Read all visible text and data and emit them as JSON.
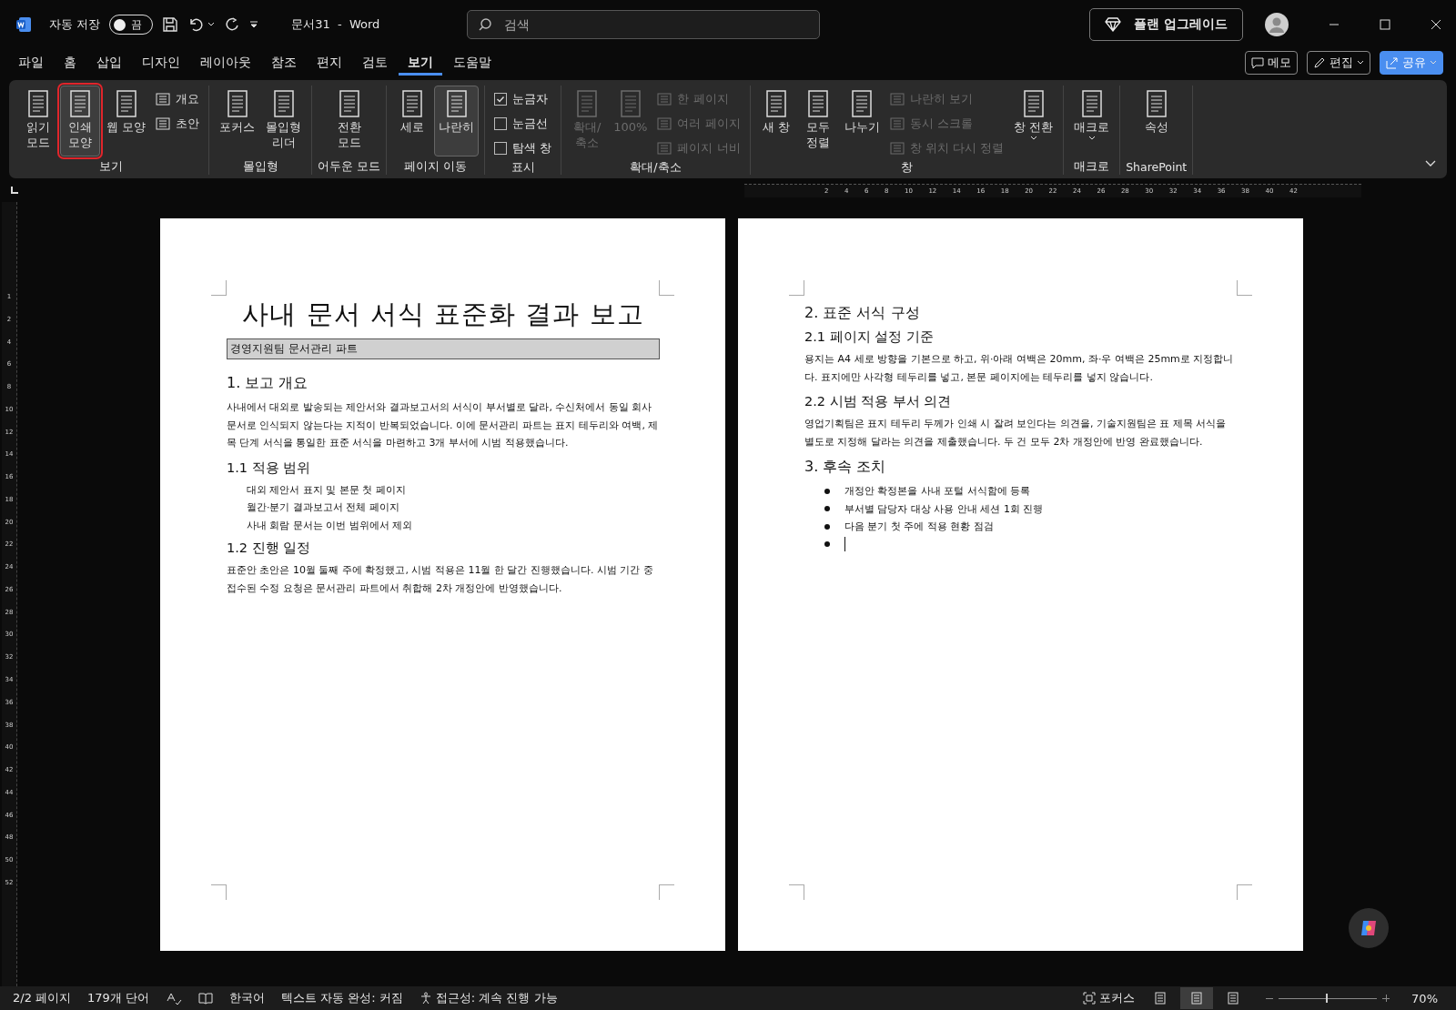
{
  "titlebar": {
    "autosave_label": "자동 저장",
    "autosave": {
      "on": false,
      "text": "끔"
    },
    "doc_title": "문서31  -  Word",
    "search": {
      "placeholder": "검색"
    },
    "upgrade_button": "플랜 업그레이드"
  },
  "menu_tabs": [
    {
      "label": "파일",
      "selected": false
    },
    {
      "label": "홈",
      "selected": false
    },
    {
      "label": "삽입",
      "selected": false
    },
    {
      "label": "디자인",
      "selected": false
    },
    {
      "label": "레이아웃",
      "selected": false
    },
    {
      "label": "참조",
      "selected": false
    },
    {
      "label": "편지",
      "selected": false
    },
    {
      "label": "검토",
      "selected": false
    },
    {
      "label": "보기",
      "selected": true
    },
    {
      "label": "도움말",
      "selected": false
    }
  ],
  "menu_buttons": [
    {
      "kind": "comment",
      "label": "메모"
    },
    {
      "kind": "edit",
      "label": "편집"
    },
    {
      "kind": "share",
      "label": "공유"
    }
  ],
  "ribbon_groups": [
    {
      "label": "보기",
      "items": [
        {
          "kind": "large",
          "label": "읽기\n모드",
          "selected": false,
          "disabled": false,
          "highlighted": false
        },
        {
          "kind": "large",
          "label": "인쇄\n모양",
          "selected": true,
          "disabled": false,
          "highlighted": true
        },
        {
          "kind": "large",
          "label": "웹 모양",
          "selected": false,
          "disabled": false,
          "highlighted": false
        },
        {
          "kind": "small",
          "label": "개요",
          "disabled": false
        },
        {
          "kind": "small",
          "label": "초안",
          "disabled": false
        }
      ]
    },
    {
      "label": "몰입형",
      "items": [
        {
          "kind": "large",
          "label": "포커스",
          "selected": false,
          "disabled": false,
          "highlighted": false
        },
        {
          "kind": "large",
          "label": "몰입형\n리더",
          "selected": false,
          "disabled": false,
          "highlighted": false
        }
      ]
    },
    {
      "label": "어두운 모드",
      "items": [
        {
          "kind": "large",
          "label": "전환\n모드",
          "selected": false,
          "disabled": false,
          "highlighted": false
        }
      ]
    },
    {
      "label": "페이지 이동",
      "items": [
        {
          "kind": "large",
          "label": "세로",
          "selected": false,
          "disabled": false,
          "highlighted": false
        },
        {
          "kind": "large",
          "label": "나란히",
          "selected": true,
          "disabled": false,
          "highlighted": false
        }
      ]
    },
    {
      "label": "표시",
      "items": [
        {
          "kind": "check",
          "label": "눈금자",
          "checked": true
        },
        {
          "kind": "check",
          "label": "눈금선",
          "checked": false
        },
        {
          "kind": "check",
          "label": "탐색 창",
          "checked": false
        }
      ]
    },
    {
      "label": "확대/축소",
      "items": [
        {
          "kind": "large",
          "label": "확대/\n축소",
          "selected": false,
          "disabled": true,
          "highlighted": false
        },
        {
          "kind": "large",
          "label": "100%",
          "selected": false,
          "disabled": true,
          "highlighted": false
        },
        {
          "kind": "small",
          "label": "한 페이지",
          "disabled": true
        },
        {
          "kind": "small",
          "label": "여러 페이지",
          "disabled": true
        },
        {
          "kind": "small",
          "label": "페이지 너비",
          "disabled": true
        }
      ]
    },
    {
      "label": "창",
      "items": [
        {
          "kind": "large",
          "label": "새 창",
          "selected": false,
          "disabled": false,
          "highlighted": false
        },
        {
          "kind": "large",
          "label": "모두\n정렬",
          "selected": false,
          "disabled": false,
          "highlighted": false
        },
        {
          "kind": "large",
          "label": "나누기",
          "selected": false,
          "disabled": false,
          "highlighted": false
        },
        {
          "kind": "small",
          "label": "나란히 보기",
          "disabled": true
        },
        {
          "kind": "small",
          "label": "동시 스크롤",
          "disabled": true
        },
        {
          "kind": "small",
          "label": "창 위치 다시 정렬",
          "disabled": true
        },
        {
          "kind": "dropdown",
          "label": "창 전환"
        }
      ]
    },
    {
      "label": "매크로",
      "items": [
        {
          "kind": "dropdown",
          "label": "매크로"
        }
      ]
    },
    {
      "label": "SharePoint",
      "items": [
        {
          "kind": "large",
          "label": "속성",
          "selected": false,
          "disabled": false,
          "highlighted": false
        }
      ]
    }
  ],
  "ruler_numbers": [
    "2",
    "4",
    "6",
    "8",
    "10",
    "12",
    "14",
    "16",
    "18",
    "20",
    "22",
    "24",
    "26",
    "28",
    "30",
    "32",
    "34",
    "36",
    "38",
    "40",
    "42"
  ],
  "vertical_ruler_numbers": [
    "1",
    "2",
    "4",
    "6",
    "8",
    "10",
    "12",
    "14",
    "16",
    "18",
    "20",
    "22",
    "24",
    "26",
    "28",
    "30",
    "32",
    "34",
    "36",
    "38",
    "40",
    "42",
    "44",
    "46",
    "48",
    "50",
    "52"
  ],
  "pages": [
    {
      "blocks": [
        {
          "kind": "title",
          "text": "사내 문서 서식 표준화 결과 보고"
        },
        {
          "kind": "subtitle",
          "text": "경영지원팀 문서관리 파트"
        },
        {
          "kind": "h1",
          "text": "1. 보고 개요"
        },
        {
          "kind": "para",
          "text": "사내에서 대외로 발송되는 제안서와 결과보고서의 서식이 부서별로 달라, 수신처에서 동일 회사 문서로 인식되지 않는다는 지적이 반복되었습니다. 이에 문서관리 파트는 표지 테두리와 여백, 제목 단계 서식을 통일한 표준 서식을 마련하고 3개 부서에 시범 적용했습니다."
        },
        {
          "kind": "h2",
          "text": "1.1 적용 범위"
        },
        {
          "kind": "indent",
          "text": "대외 제안서 표지 및 본문 첫 페이지"
        },
        {
          "kind": "indent",
          "text": "월간·분기 결과보고서 전체 페이지"
        },
        {
          "kind": "indent",
          "text": "사내 회람 문서는 이번 범위에서 제외"
        },
        {
          "kind": "h2",
          "text": "1.2 진행 일정"
        },
        {
          "kind": "para",
          "text": "표준안 초안은 10월 둘째 주에 확정했고, 시범 적용은 11월 한 달간 진행했습니다. 시범 기간 중 접수된 수정 요청은 문서관리 파트에서 취합해 2차 개정안에 반영했습니다."
        }
      ]
    },
    {
      "blocks": [
        {
          "kind": "h1",
          "text": "2. 표준 서식 구성"
        },
        {
          "kind": "h2",
          "text": "2.1 페이지 설정 기준"
        },
        {
          "kind": "para",
          "text": "용지는 A4 세로 방향을 기본으로 하고, 위·아래 여백은 20mm, 좌·우 여백은 25mm로 지정합니다. 표지에만 사각형 테두리를 넣고, 본문 페이지에는 테두리를 넣지 않습니다."
        },
        {
          "kind": "h2",
          "text": "2.2 시범 적용 부서 의견"
        },
        {
          "kind": "para",
          "text": "영업기획팀은 표지 테두리 두께가 인쇄 시 잘려 보인다는 의견을, 기술지원팀은 표 제목 서식을 별도로 지정해 달라는 의견을 제출했습니다. 두 건 모두 2차 개정안에 반영 완료했습니다."
        },
        {
          "kind": "h1",
          "text": "3. 후속 조치"
        },
        {
          "kind": "bullet",
          "text": "개정안 확정본을 사내 포털 서식함에 등록"
        },
        {
          "kind": "bullet",
          "text": "부서별 담당자 대상 사용 안내 세션 1회 진행"
        },
        {
          "kind": "bullet",
          "text": "다음 분기 첫 주에 적용 현황 점검"
        },
        {
          "kind": "cursor_bullet"
        }
      ]
    }
  ],
  "status_bar": {
    "left": [
      {
        "kind": "text",
        "text": "2/2 페이지"
      },
      {
        "kind": "text",
        "text": "179개 단어"
      },
      {
        "kind": "proof"
      },
      {
        "kind": "book"
      },
      {
        "kind": "text",
        "text": "한국어"
      },
      {
        "kind": "text",
        "text": "텍스트 자동 완성: 커짐"
      },
      {
        "kind": "access",
        "text": "접근성: 계속 진행 가능"
      }
    ],
    "focus": "포커스",
    "views": [
      {
        "selected": false
      },
      {
        "selected": true
      },
      {
        "selected": false
      }
    ],
    "zoom": {
      "level": 0.48,
      "text": "70%"
    }
  }
}
